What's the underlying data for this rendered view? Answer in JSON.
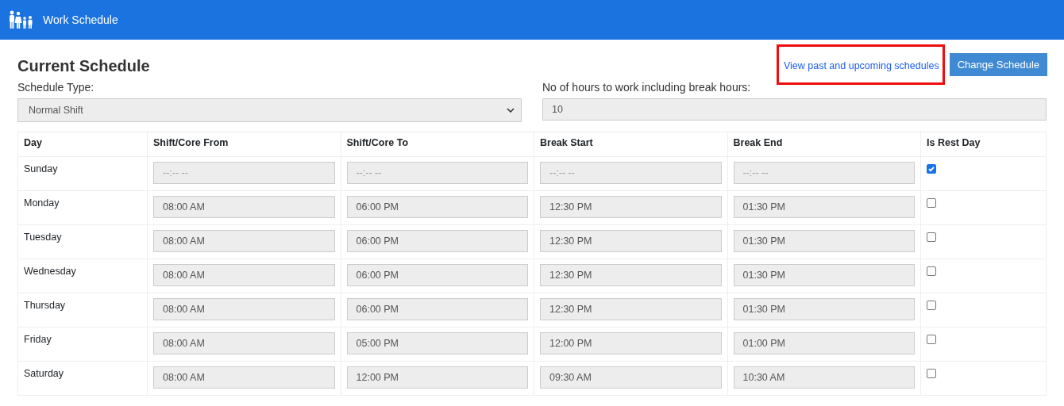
{
  "header": {
    "title": "Work Schedule"
  },
  "page": {
    "title": "Current Schedule"
  },
  "actions": {
    "link": {
      "label": "View past and upcoming schedules",
      "highlighted": true
    },
    "button": "Change Schedule"
  },
  "schedule_type": {
    "label": "Schedule Type:",
    "value": "Normal Shift"
  },
  "hours": {
    "label": "No of hours to work including break hours:",
    "value": "10"
  },
  "table": {
    "columns": [
      "Day",
      "Shift/Core From",
      "Shift/Core To",
      "Break Start",
      "Break End",
      "Is Rest Day"
    ],
    "rows": [
      {
        "day": "Sunday",
        "times": [
          {
            "placeholder": "--:-- --"
          },
          {
            "placeholder": "--:-- --"
          },
          {
            "placeholder": "--:-- --"
          },
          {
            "placeholder": "--:-- --"
          }
        ],
        "rest_day": true
      },
      {
        "day": "Monday",
        "times": [
          {
            "value": "08:00 AM"
          },
          {
            "value": "06:00 PM"
          },
          {
            "value": "12:30 PM"
          },
          {
            "value": "01:30 PM"
          }
        ],
        "rest_day": false
      },
      {
        "day": "Tuesday",
        "times": [
          {
            "value": "08:00 AM"
          },
          {
            "value": "06:00 PM"
          },
          {
            "value": "12:30 PM"
          },
          {
            "value": "01:30 PM"
          }
        ],
        "rest_day": false
      },
      {
        "day": "Wednesday",
        "times": [
          {
            "value": "08:00 AM"
          },
          {
            "value": "06:00 PM"
          },
          {
            "value": "12:30 PM"
          },
          {
            "value": "01:30 PM"
          }
        ],
        "rest_day": false
      },
      {
        "day": "Thursday",
        "times": [
          {
            "value": "08:00 AM"
          },
          {
            "value": "06:00 PM"
          },
          {
            "value": "12:30 PM"
          },
          {
            "value": "01:30 PM"
          }
        ],
        "rest_day": false
      },
      {
        "day": "Friday",
        "times": [
          {
            "value": "08:00 AM"
          },
          {
            "value": "05:00 PM"
          },
          {
            "value": "12:00 PM"
          },
          {
            "value": "01:00 PM"
          }
        ],
        "rest_day": false
      },
      {
        "day": "Saturday",
        "times": [
          {
            "value": "08:00 AM"
          },
          {
            "value": "12:00 PM"
          },
          {
            "value": "09:30 AM"
          },
          {
            "value": "10:30 AM"
          }
        ],
        "rest_day": false
      }
    ]
  }
}
